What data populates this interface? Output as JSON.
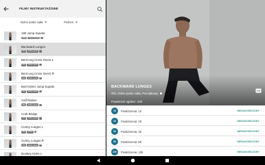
{
  "appbar": {
    "title": "FILMY INSTRUKTAŻOWE",
    "back_icon": "arrow-left-icon",
    "search_icon": "search-icon"
  },
  "filters": {
    "body_part": "Dolne partie ciała",
    "level": "Poziom"
  },
  "exercises": [
    {
      "name": "180 Jump Squats",
      "tags": [
        "ABC",
        "Jump Squats"
      ]
    },
    {
      "name": "Backward Lunges",
      "tags": [
        "#91",
        "Dolne partie"
      ],
      "selected": true
    },
    {
      "name": "Bent-Leg Cross Overs L",
      "tags": [
        "#41",
        "Dolne partie"
      ]
    },
    {
      "name": "Bent-Leg Cross Overs R",
      "tags": [
        "#42",
        "Dolne partie"
      ]
    },
    {
      "name": "Butt Kicker Jump Squats",
      "tags": [
        "#12",
        "Dolne partie"
      ]
    },
    {
      "name": "Calf Raises",
      "tags": [
        "#64",
        "Dolne partie"
      ]
    },
    {
      "name": "Crab Bridge",
      "tags": [
        "#72",
        "Dolne partie"
      ]
    },
    {
      "name": "Curtsy Lunges L",
      "tags": [
        "#51",
        "Dolne"
      ]
    },
    {
      "name": "Curtsy Lunges R",
      "tags": [
        "#52",
        "Dolne partie"
      ]
    },
    {
      "name": "Donkey Kicks L",
      "tags": [
        "#31",
        "Dolne"
      ]
    }
  ],
  "detail": {
    "title": "BACKWARD LUNGES",
    "subtitle": "#91, Dolne partie ciała, Początkowy,",
    "total": "Powtórzeń ogółem: 220",
    "video_icon": "subtitles-icon"
  },
  "sets": [
    {
      "num": "10",
      "label": "Powtórzenia: 10",
      "status": "NIEZAKOŃCZONY"
    },
    {
      "num": "20",
      "label": "Powtórzenia: 20",
      "status": "NIEZAKOŃCZONY"
    },
    {
      "num": "30",
      "label": "Powtórzenia: 30",
      "status": "NIEZAKOŃCZONY"
    },
    {
      "num": "50",
      "label": "Powtórzenia: 50",
      "status": "NIEZAKOŃCZONY"
    },
    {
      "num": "100",
      "label": "Powtórzenia: 100",
      "status": "NIEZAKOŃCZONY"
    },
    {
      "num": "150",
      "label": "Powtórzenia: 150",
      "status": "NIEZAKOŃCZONY"
    }
  ],
  "navbar": [
    "back-nav-icon",
    "home-nav-icon",
    "recents-nav-icon"
  ],
  "colors": {
    "accent": "#1f6f8b",
    "status": "#2f8f86",
    "selected_row": "#dcdcdc"
  }
}
